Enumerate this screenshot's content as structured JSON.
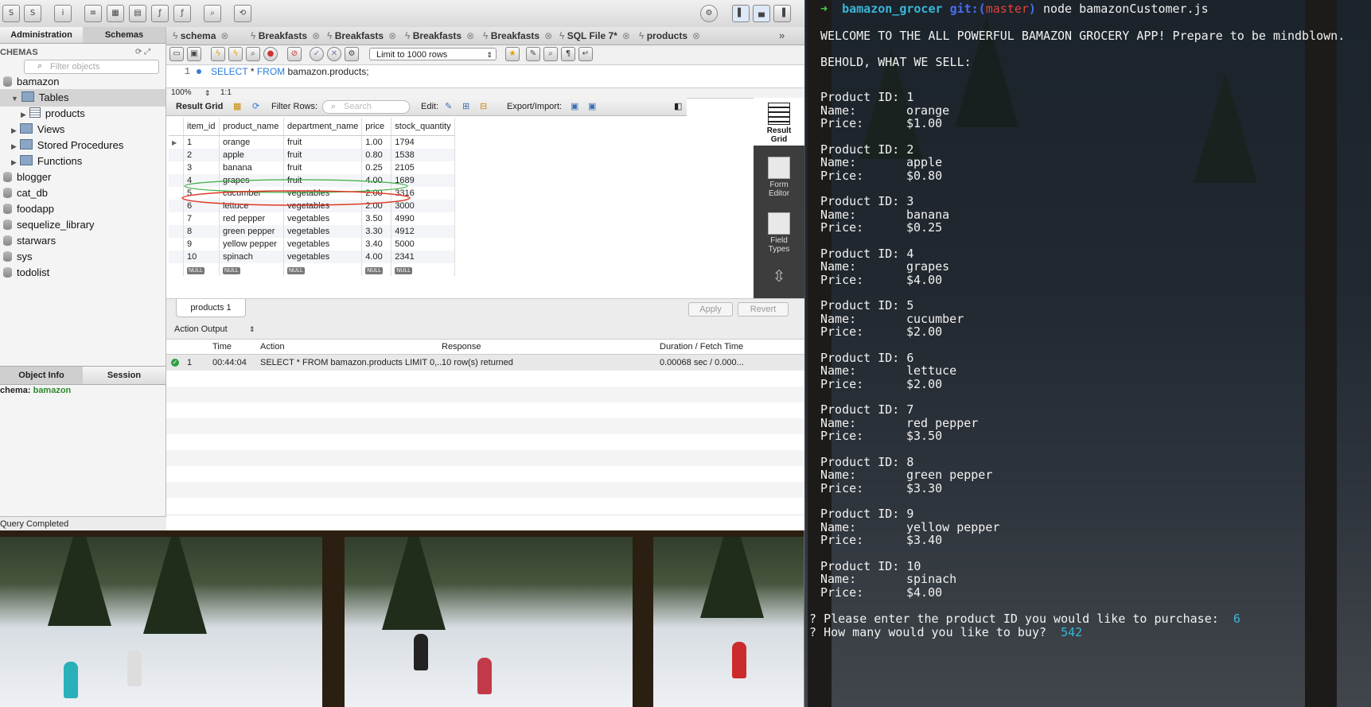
{
  "workbench": {
    "sidebar_tabs": [
      "Administration",
      "Schemas"
    ],
    "schemas_header": "CHEMAS",
    "filter_placeholder": "Filter objects",
    "tree": [
      {
        "name": "bamazon",
        "kind": "db"
      },
      {
        "name": "Tables",
        "kind": "folder",
        "selected": true
      },
      {
        "name": "products",
        "kind": "table"
      },
      {
        "name": "Views",
        "kind": "folder"
      },
      {
        "name": "Stored Procedures",
        "kind": "folder"
      },
      {
        "name": "Functions",
        "kind": "folder"
      },
      {
        "name": "blogger",
        "kind": "db"
      },
      {
        "name": "cat_db",
        "kind": "db"
      },
      {
        "name": "foodapp",
        "kind": "db"
      },
      {
        "name": "sequelize_library",
        "kind": "db"
      },
      {
        "name": "starwars",
        "kind": "db"
      },
      {
        "name": "sys",
        "kind": "db"
      },
      {
        "name": "todolist",
        "kind": "db"
      }
    ],
    "info_tabs": [
      "Object Info",
      "Session"
    ],
    "schema_info_label": "chema:",
    "schema_info_value": "bamazon",
    "status": "Query Completed",
    "doc_tabs": [
      "schema",
      "Breakfasts",
      "Breakfasts",
      "Breakfasts",
      "Breakfasts",
      "SQL File 7*",
      "products"
    ],
    "limit_select": "Limit to 1000 rows",
    "query_line_no": "1",
    "query_keyword1": "SELECT",
    "query_star": "*",
    "query_keyword2": "FROM",
    "query_rest": "bamazon.products;",
    "zoom": "100%",
    "cursor_pos": "1:1",
    "result_bar": {
      "result_grid": "Result Grid",
      "filter_rows": "Filter Rows:",
      "search_placeholder": "Search",
      "edit": "Edit:",
      "export": "Export/Import:"
    },
    "columns": [
      "item_id",
      "product_name",
      "department_name",
      "price",
      "stock_quantity"
    ],
    "rows": [
      [
        "1",
        "orange",
        "fruit",
        "1.00",
        "1794"
      ],
      [
        "2",
        "apple",
        "fruit",
        "0.80",
        "1538"
      ],
      [
        "3",
        "banana",
        "fruit",
        "0.25",
        "2105"
      ],
      [
        "4",
        "grapes",
        "fruit",
        "4.00",
        "1689"
      ],
      [
        "5",
        "cucumber",
        "vegetables",
        "2.00",
        "3316"
      ],
      [
        "6",
        "lettuce",
        "vegetables",
        "2.00",
        "3000"
      ],
      [
        "7",
        "red pepper",
        "vegetables",
        "3.50",
        "4990"
      ],
      [
        "8",
        "green pepper",
        "vegetables",
        "3.30",
        "4912"
      ],
      [
        "9",
        "yellow pepper",
        "vegetables",
        "3.40",
        "5000"
      ],
      [
        "10",
        "spinach",
        "vegetables",
        "4.00",
        "2341"
      ]
    ],
    "null_label": "NULL",
    "side_buttons": [
      "Result\nGrid",
      "Form\nEditor",
      "Field\nTypes"
    ],
    "result_tab": "products 1",
    "apply": "Apply",
    "revert": "Revert",
    "action_output_label": "Action Output",
    "output_columns": [
      "Time",
      "Action",
      "Response",
      "Duration / Fetch Time"
    ],
    "output_row": {
      "num": "1",
      "time": "00:44:04",
      "action": "SELECT * FROM bamazon.products LIMIT 0,...",
      "response": "10 row(s) returned",
      "duration": "0.00068 sec / 0.000..."
    },
    "annotation_colors": {
      "lettuce": "#3fae3f",
      "red_pepper": "#e0392b"
    }
  },
  "terminal": {
    "prompt_arrow": "➜",
    "dir": "bamazon_grocer",
    "git_label": "git:(",
    "branch": "master",
    "git_close": ")",
    "command": "node bamazonCustomer.js",
    "welcome": "WELCOME TO THE ALL POWERFUL BAMAZON GROCERY APP! Prepare to be mindblown.",
    "behold": "BEHOLD, WHAT WE SELL:",
    "label_id": "Product ID:",
    "label_name": "Name:",
    "label_price": "Price:",
    "products": [
      {
        "id": "1",
        "name": "orange",
        "price": "$1.00"
      },
      {
        "id": "2",
        "name": "apple",
        "price": "$0.80"
      },
      {
        "id": "3",
        "name": "banana",
        "price": "$0.25"
      },
      {
        "id": "4",
        "name": "grapes",
        "price": "$4.00"
      },
      {
        "id": "5",
        "name": "cucumber",
        "price": "$2.00"
      },
      {
        "id": "6",
        "name": "lettuce",
        "price": "$2.00"
      },
      {
        "id": "7",
        "name": "red pepper",
        "price": "$3.50"
      },
      {
        "id": "8",
        "name": "green pepper",
        "price": "$3.30"
      },
      {
        "id": "9",
        "name": "yellow pepper",
        "price": "$3.40"
      },
      {
        "id": "10",
        "name": "spinach",
        "price": "$4.00"
      }
    ],
    "question_mark": "?",
    "q1": "Please enter the product ID you would like to purchase:",
    "a1": "6",
    "q2": "How many would you like to buy?",
    "a2": "542",
    "colors": {
      "arrow": "#4cd04c",
      "dir": "#3ab5d8",
      "git": "#4b6cf0",
      "branch": "#e0433a",
      "answer": "#3ab5d8"
    }
  }
}
